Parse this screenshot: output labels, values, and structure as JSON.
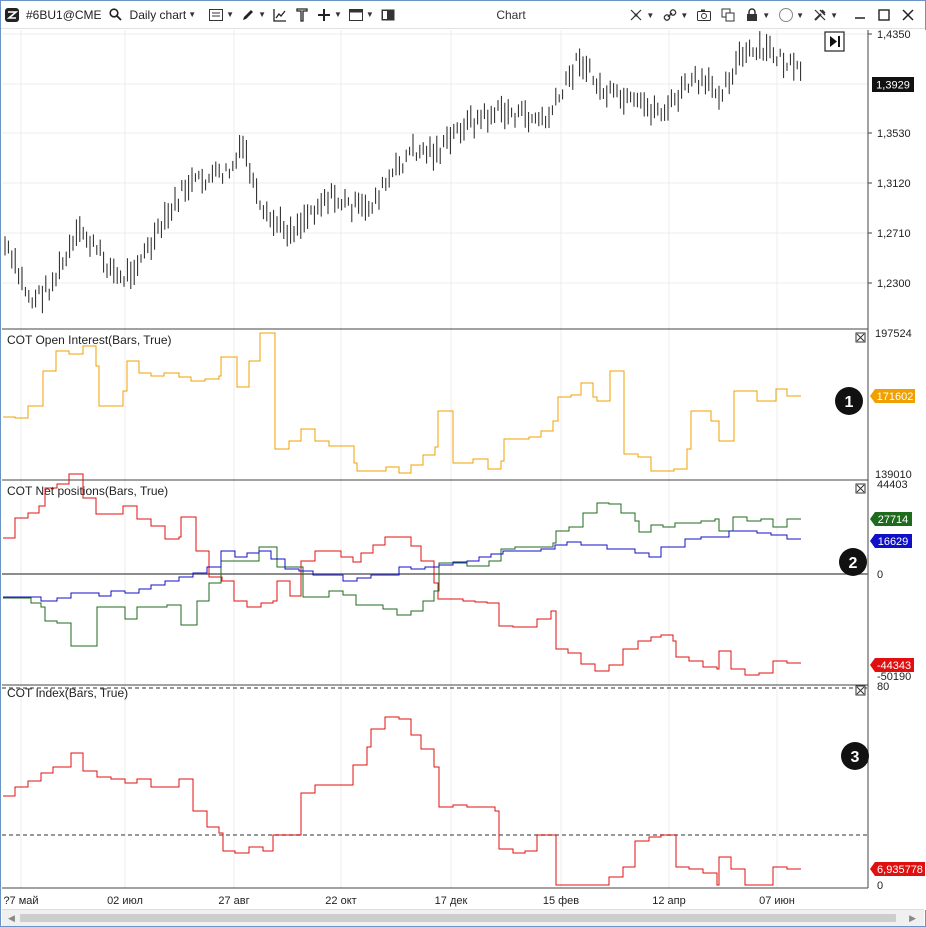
{
  "toolbar": {
    "symbol": "#6BU1@CME",
    "chart_mode": "Daily chart",
    "window_title": "Chart"
  },
  "main_pane": {
    "price_label": "1,3929",
    "ticks": [
      "1,4350",
      "1,3530",
      "1,3120",
      "1,2710",
      "1,2300"
    ]
  },
  "pane1": {
    "title": "COT Open Interest(Bars, True)",
    "badge": "1",
    "scale_top": "197524",
    "scale_bottom": "139010",
    "value_label": "171602",
    "color": "#f0a000"
  },
  "pane2": {
    "title": "COT Net positions(Bars, True)",
    "badge": "2",
    "scale_top": "44403",
    "scale_zero": "0",
    "scale_bottom": "-50190",
    "labels": {
      "green": "27714",
      "blue": "16629",
      "red": "-44343"
    },
    "colors": {
      "green": "#1e6b1e",
      "blue": "#1010c8",
      "red": "#e01010"
    }
  },
  "pane3": {
    "title": "COT Index(Bars, True)",
    "badge": "3",
    "scale_top": "80",
    "scale_bottom": "0",
    "value_label": "6,935778",
    "color": "#e01010"
  },
  "x_axis": {
    "labels": [
      "?7 май",
      "02 июл",
      "27 авг",
      "22 окт",
      "17 дек",
      "15 фев",
      "12 апр",
      "07 июн"
    ]
  }
}
